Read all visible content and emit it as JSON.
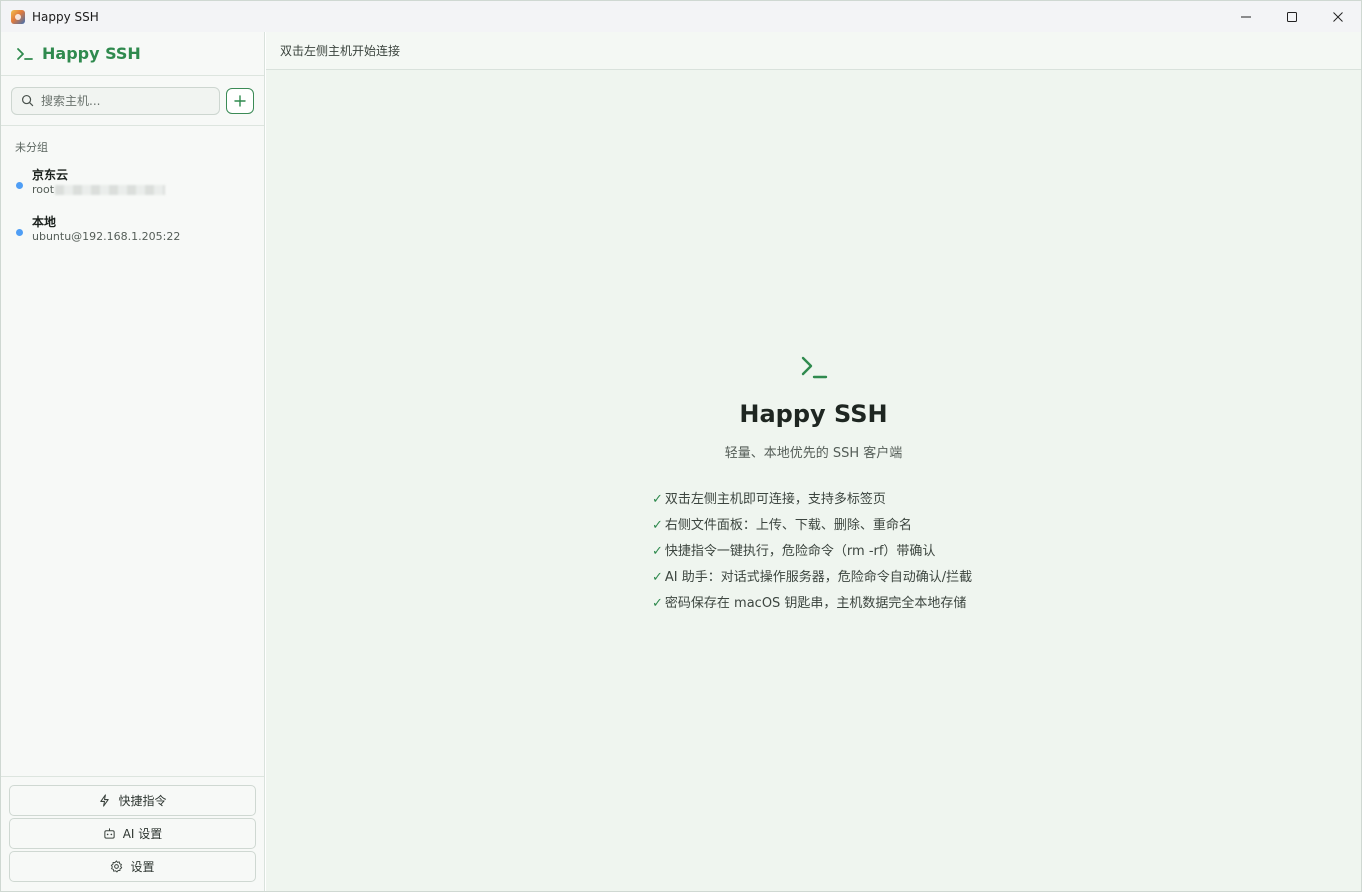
{
  "window": {
    "title": "Happy SSH",
    "controls": [
      "minimize-icon",
      "maximize-icon",
      "close-icon"
    ]
  },
  "sidebar": {
    "brand": "Happy SSH",
    "search": {
      "placeholder": "搜索主机...",
      "value": ""
    },
    "group_label": "未分组",
    "hosts": [
      {
        "name": "京东云",
        "address": "root",
        "address_obscured": true,
        "status_color": "#4f9ef5"
      },
      {
        "name": "本地",
        "address": "ubuntu@192.168.1.205:22",
        "status_color": "#4f9ef5"
      }
    ],
    "buttons": {
      "quick_commands": "快捷指令",
      "ai_settings": "AI 设置",
      "settings": "设置"
    }
  },
  "main": {
    "header": "双击左侧主机开始连接",
    "welcome": {
      "title": "Happy SSH",
      "subtitle": "轻量、本地优先的 SSH 客户端",
      "features": [
        "双击左侧主机即可连接，支持多标签页",
        "右侧文件面板：上传、下载、删除、重命名",
        "快捷指令一键执行，危险命令（rm -rf）带确认",
        "AI 助手：对话式操作服务器，危险命令自动确认/拦截",
        "密码保存在 macOS 钥匙串，主机数据完全本地存储"
      ],
      "check_mark": "✓"
    }
  },
  "colors": {
    "accent": "#2f8a4e",
    "status_dot": "#4f9ef5",
    "main_bg": "#eff5ef",
    "sidebar_bg": "#f7f9f7"
  }
}
